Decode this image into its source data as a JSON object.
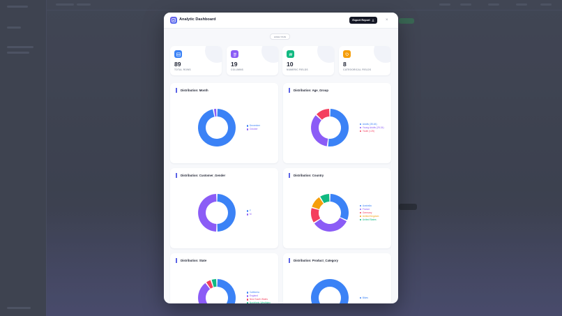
{
  "modal": {
    "title": "Analytic Dashboard",
    "export_label": "Export Report",
    "close_symbol": "×",
    "section_tag": "ANALYSIS"
  },
  "stats": [
    {
      "value": "89",
      "label": "TOTAL ROWS",
      "color": "#3b82f6",
      "icon": "table-icon"
    },
    {
      "value": "19",
      "label": "COLUMNS",
      "color": "#8b5cf6",
      "icon": "columns-icon"
    },
    {
      "value": "10",
      "label": "NUMERIC FIELDS",
      "color": "#10b981",
      "icon": "hash-icon"
    },
    {
      "value": "8",
      "label": "CATEGORICAL FIELDS",
      "color": "#f59e0b",
      "icon": "tag-icon"
    }
  ],
  "chart_data": [
    {
      "type": "pie",
      "title": "Distribution: Month",
      "labels": [
        "December",
        "October"
      ],
      "values": [
        97,
        3
      ],
      "colors": [
        "#3b82f6",
        "#8b5cf6"
      ]
    },
    {
      "type": "pie",
      "title": "Distribution: Age_Group",
      "labels": [
        "Adults (35-64)",
        "Young Adults (25-34)",
        "Youth (<25)"
      ],
      "values": [
        52,
        35,
        13
      ],
      "colors": [
        "#3b82f6",
        "#8b5cf6",
        "#f43f5e"
      ]
    },
    {
      "type": "pie",
      "title": "Distribution: Customer_Gender",
      "labels": [
        "F",
        "M"
      ],
      "values": [
        50,
        50
      ],
      "colors": [
        "#3b82f6",
        "#8b5cf6"
      ]
    },
    {
      "type": "pie",
      "title": "Distribution: Country",
      "labels": [
        "Australia",
        "France",
        "Germany",
        "United Kingdom",
        "United States"
      ],
      "values": [
        28,
        30,
        12,
        10,
        8
      ],
      "colors": [
        "#3b82f6",
        "#8b5cf6",
        "#f43f5e",
        "#f59e0b",
        "#10b981"
      ]
    },
    {
      "type": "pie",
      "title": "Distribution: State",
      "labels": [
        "California",
        "England",
        "New South Wales",
        "Nordrhein-Westfalen"
      ],
      "values": [
        45,
        45,
        5,
        5
      ],
      "colors": [
        "#3b82f6",
        "#8b5cf6",
        "#f43f5e",
        "#10b981"
      ]
    },
    {
      "type": "pie",
      "title": "Distribution: Product_Category",
      "labels": [
        "Bikes"
      ],
      "values": [
        100
      ],
      "colors": [
        "#3b82f6"
      ]
    }
  ]
}
